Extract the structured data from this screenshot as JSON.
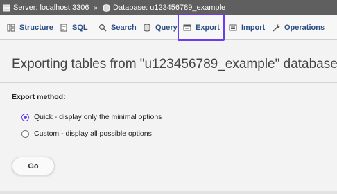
{
  "breadcrumb": {
    "server_label": "Server: localhost:3306",
    "separator": "»",
    "database_label": "Database: u123456789_example"
  },
  "tabs": [
    {
      "label": "Structure",
      "icon": "structure-icon"
    },
    {
      "label": "SQL",
      "icon": "sql-icon"
    },
    {
      "label": "Search",
      "icon": "search-icon"
    },
    {
      "label": "Query",
      "icon": "query-icon"
    },
    {
      "label": "Export",
      "icon": "export-icon",
      "highlighted": true
    },
    {
      "label": "Import",
      "icon": "import-icon"
    },
    {
      "label": "Operations",
      "icon": "wrench-icon"
    }
  ],
  "main": {
    "title": "Exporting tables from \"u123456789_example\" database",
    "export_method_label": "Export method:",
    "options": [
      {
        "label": "Quick - display only the minimal options",
        "selected": true
      },
      {
        "label": "Custom - display all possible options",
        "selected": false
      }
    ],
    "go_label": "Go"
  },
  "colors": {
    "accent": "#6b3df0",
    "tab_text": "#2a4d84",
    "breadcrumb_bg": "#5f5f5f"
  }
}
